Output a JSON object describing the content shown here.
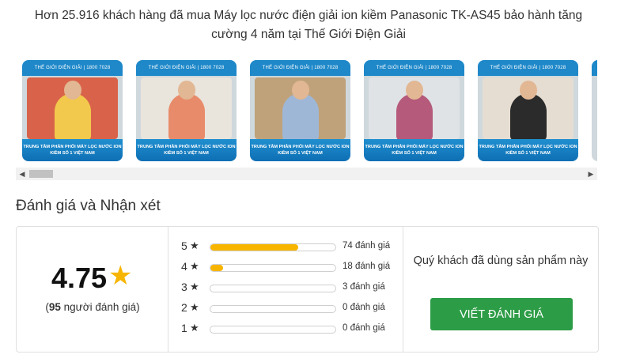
{
  "headline": "Hơn 25.916 khách hàng đã mua Máy lọc nước điện giải ion kiềm Panasonic TK-AS45 bảo hành tăng cường 4 năm tại Thế Giới Điện Giải",
  "photos": [
    {
      "top_text": "THẾ GIỚI ĐIỆN GIẢI  |  1800 7028",
      "bottom_text": "TRUNG TÂM PHÂN PHỐI MÁY LỌC NƯỚC ION KIỀM SỐ 1 VIỆT NAM",
      "shirt": "#f2c94c",
      "scene": "#d9634a"
    },
    {
      "top_text": "THẾ GIỚI ĐIỆN GIẢI  |  1800 7028",
      "bottom_text": "TRUNG TÂM PHÂN PHỐI MÁY LỌC NƯỚC ION KIỀM SỐ 1 VIỆT NAM",
      "shirt": "#e88b6a",
      "scene": "#e9e4dc"
    },
    {
      "top_text": "THẾ GIỚI ĐIỆN GIẢI  |  1800 7028",
      "bottom_text": "TRUNG TÂM PHÂN PHỐI MÁY LỌC NƯỚC ION KIỀM SỐ 1 VIỆT NAM",
      "shirt": "#9fb7d6",
      "scene": "#bfa27a"
    },
    {
      "top_text": "THẾ GIỚI ĐIỆN GIẢI  |  1800 7028",
      "bottom_text": "TRUNG TÂM PHÂN PHỐI MÁY LỌC NƯỚC ION KIỀM SỐ 1 VIỆT NAM",
      "shirt": "#b55a7a",
      "scene": "#dfe3e6"
    },
    {
      "top_text": "THẾ GIỚI ĐIỆN GIẢI  |  1800 7028",
      "bottom_text": "TRUNG TÂM PHÂN PHỐI MÁY LỌC NƯỚC ION KIỀM SỐ 1 VIỆT NAM",
      "shirt": "#2b2b2b",
      "scene": "#e6ddd2"
    }
  ],
  "scroll": {
    "left_arrow": "◀",
    "right_arrow": "▶"
  },
  "section_title": "Đánh giá và Nhận xét",
  "summary": {
    "average": "4.75",
    "star": "★",
    "count_open": "(",
    "count": "95",
    "count_suffix": " người đánh giá)"
  },
  "breakdown": [
    {
      "stars": "5",
      "count_label": "74 đánh giá",
      "fraction": 0.7
    },
    {
      "stars": "4",
      "count_label": "18 đánh giá",
      "fraction": 0.1
    },
    {
      "stars": "3",
      "count_label": "3 đánh giá",
      "fraction": 0
    },
    {
      "stars": "2",
      "count_label": "0 đánh giá",
      "fraction": 0
    },
    {
      "stars": "1",
      "count_label": "0 đánh giá",
      "fraction": 0
    }
  ],
  "cta": {
    "prompt": "Quý khách đã dùng sản phẩm này",
    "button": "VIẾT ĐÁNH GIÁ"
  },
  "colors": {
    "star": "#f7b500",
    "button": "#2d9c46",
    "brand_blue": "#1e88c9"
  }
}
